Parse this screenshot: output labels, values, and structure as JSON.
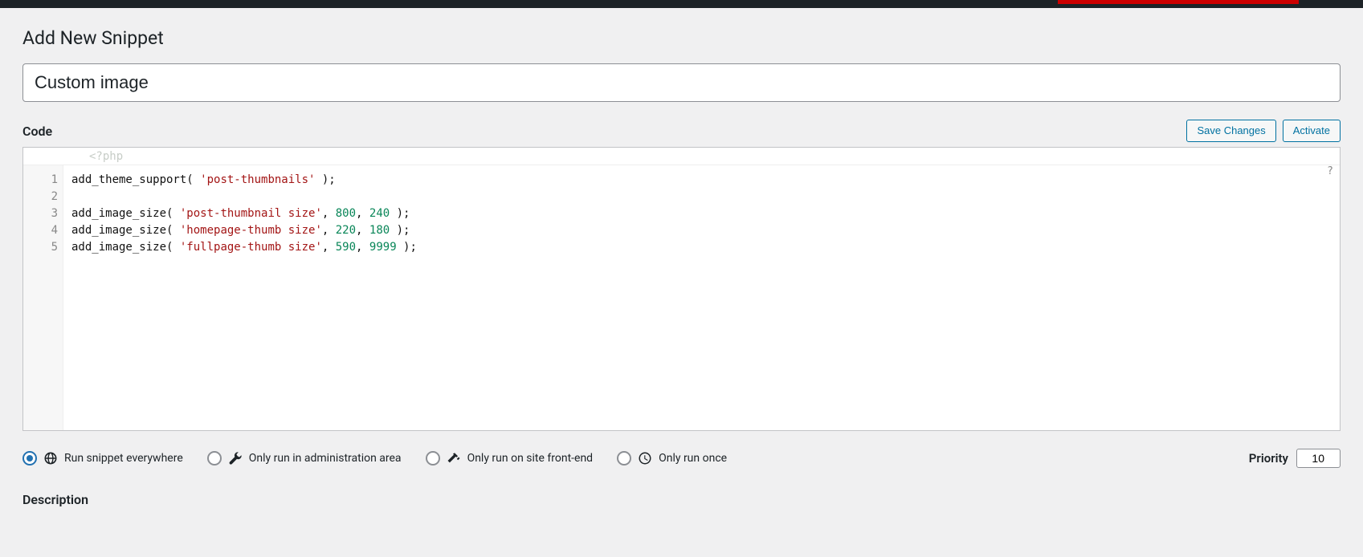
{
  "page": {
    "title": "Add New Snippet"
  },
  "snippet": {
    "title_value": "Custom image"
  },
  "sections": {
    "code_heading": "Code",
    "description_heading": "Description"
  },
  "buttons": {
    "save": "Save Changes",
    "activate": "Activate"
  },
  "editor": {
    "php_open": "<?php",
    "help_symbol": "?",
    "line_numbers": [
      "1",
      "2",
      "3",
      "4",
      "5"
    ],
    "lines": [
      {
        "tokens": [
          {
            "t": "func",
            "v": "add_theme_support"
          },
          {
            "t": "punc",
            "v": "( "
          },
          {
            "t": "str",
            "v": "'post-thumbnails'"
          },
          {
            "t": "punc",
            "v": " );"
          }
        ]
      },
      {
        "tokens": []
      },
      {
        "tokens": [
          {
            "t": "func",
            "v": "add_image_size"
          },
          {
            "t": "punc",
            "v": "( "
          },
          {
            "t": "str",
            "v": "'post-thumbnail size'"
          },
          {
            "t": "punc",
            "v": ", "
          },
          {
            "t": "num",
            "v": "800"
          },
          {
            "t": "punc",
            "v": ", "
          },
          {
            "t": "num",
            "v": "240"
          },
          {
            "t": "punc",
            "v": " );"
          }
        ]
      },
      {
        "tokens": [
          {
            "t": "func",
            "v": "add_image_size"
          },
          {
            "t": "punc",
            "v": "( "
          },
          {
            "t": "str",
            "v": "'homepage-thumb size'"
          },
          {
            "t": "punc",
            "v": ", "
          },
          {
            "t": "num",
            "v": "220"
          },
          {
            "t": "punc",
            "v": ", "
          },
          {
            "t": "num",
            "v": "180"
          },
          {
            "t": "punc",
            "v": " );"
          }
        ]
      },
      {
        "tokens": [
          {
            "t": "func",
            "v": "add_image_size"
          },
          {
            "t": "punc",
            "v": "( "
          },
          {
            "t": "str",
            "v": "'fullpage-thumb size'"
          },
          {
            "t": "punc",
            "v": ", "
          },
          {
            "t": "num",
            "v": "590"
          },
          {
            "t": "punc",
            "v": ", "
          },
          {
            "t": "num",
            "v": "9999"
          },
          {
            "t": "punc",
            "v": " );"
          }
        ]
      }
    ]
  },
  "scope_options": [
    {
      "key": "everywhere",
      "label": "Run snippet everywhere",
      "icon": "globe-icon",
      "checked": true
    },
    {
      "key": "admin",
      "label": "Only run in administration area",
      "icon": "wrench-icon",
      "checked": false
    },
    {
      "key": "frontend",
      "label": "Only run on site front-end",
      "icon": "hammer-icon",
      "checked": false
    },
    {
      "key": "once",
      "label": "Only run once",
      "icon": "clock-icon",
      "checked": false
    }
  ],
  "priority": {
    "label": "Priority",
    "value": "10"
  }
}
